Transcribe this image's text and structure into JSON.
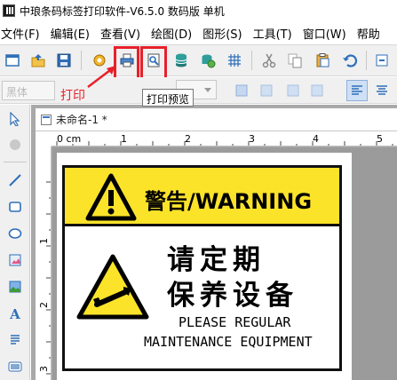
{
  "window": {
    "title": "中琅条码标签打印软件-V6.5.0 数码版 单机"
  },
  "menu": [
    "文件(F)",
    "编辑(E)",
    "查看(V)",
    "绘图(D)",
    "图形(S)",
    "工具(T)",
    "窗口(W)",
    "帮助"
  ],
  "toolbar": {
    "buttons": [
      "new-icon",
      "open-icon",
      "save-icon",
      "settings-icon",
      "print-icon",
      "print-preview-icon",
      "database-icon",
      "database-setup-icon",
      "grid-icon",
      "cut-icon",
      "copy-icon",
      "paste-icon",
      "undo-icon"
    ],
    "highlight_color": "#e8202a"
  },
  "annotations": {
    "print_label": "打印",
    "tooltip": "打印预览"
  },
  "format_bar": {
    "font_name": "黑体"
  },
  "palette": [
    "select-icon",
    "pan-icon",
    "line-icon",
    "rectangle-icon",
    "ellipse-icon",
    "picture-icon",
    "image-icon",
    "text-icon",
    "rich-text-icon",
    "barcode-icon"
  ],
  "document": {
    "tab_title": "未命名-1 *",
    "ruler_top": [
      "0 cm",
      "1",
      "2",
      "3",
      "4",
      "5"
    ],
    "ruler_left": [
      "1",
      "2",
      "3"
    ]
  },
  "sign": {
    "header": "警告/WARNING",
    "line1_cn": "请定期",
    "line2_cn": "保养设备",
    "line1_en": "PLEASE REGULAR",
    "line2_en": "MAINTENANCE EQUIPMENT",
    "header_color": "#fbe329"
  }
}
